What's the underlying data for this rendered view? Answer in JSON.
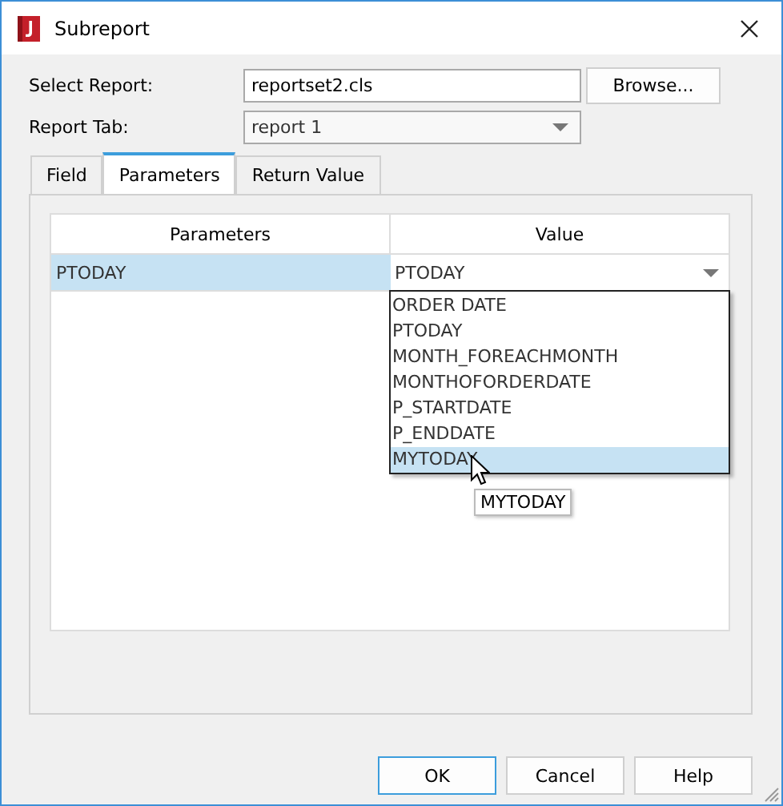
{
  "window": {
    "title": "Subreport"
  },
  "form": [
    {
      "label": "Select Report:",
      "kind": "text",
      "value": "reportset2.cls",
      "button": "Browse..."
    },
    {
      "label": "Report Tab:",
      "kind": "dropdown",
      "value": "report 1"
    }
  ],
  "tabs": [
    {
      "label": "Field",
      "selected": false
    },
    {
      "label": "Parameters",
      "selected": true
    },
    {
      "label": "Return Value",
      "selected": false
    }
  ],
  "table": {
    "columns": [
      "Parameters",
      "Value"
    ],
    "rows": [
      {
        "cells": [
          "PTODAY",
          "PTODAY"
        ],
        "selected": true
      }
    ]
  },
  "dropdown_list": [
    {
      "label": "ORDER DATE",
      "selected": false
    },
    {
      "label": "PTODAY",
      "selected": false
    },
    {
      "label": "MONTH_FOREACHMONTH",
      "selected": false
    },
    {
      "label": "MONTHOFORDERDATE",
      "selected": false
    },
    {
      "label": "P_STARTDATE",
      "selected": false
    },
    {
      "label": "P_ENDDATE",
      "selected": false
    },
    {
      "label": "MYTODAY",
      "selected": true
    }
  ],
  "tooltip": "MYTODAY",
  "buttons": [
    {
      "label": "OK",
      "default": true
    },
    {
      "label": "Cancel",
      "default": false
    },
    {
      "label": "Help",
      "default": false
    }
  ]
}
